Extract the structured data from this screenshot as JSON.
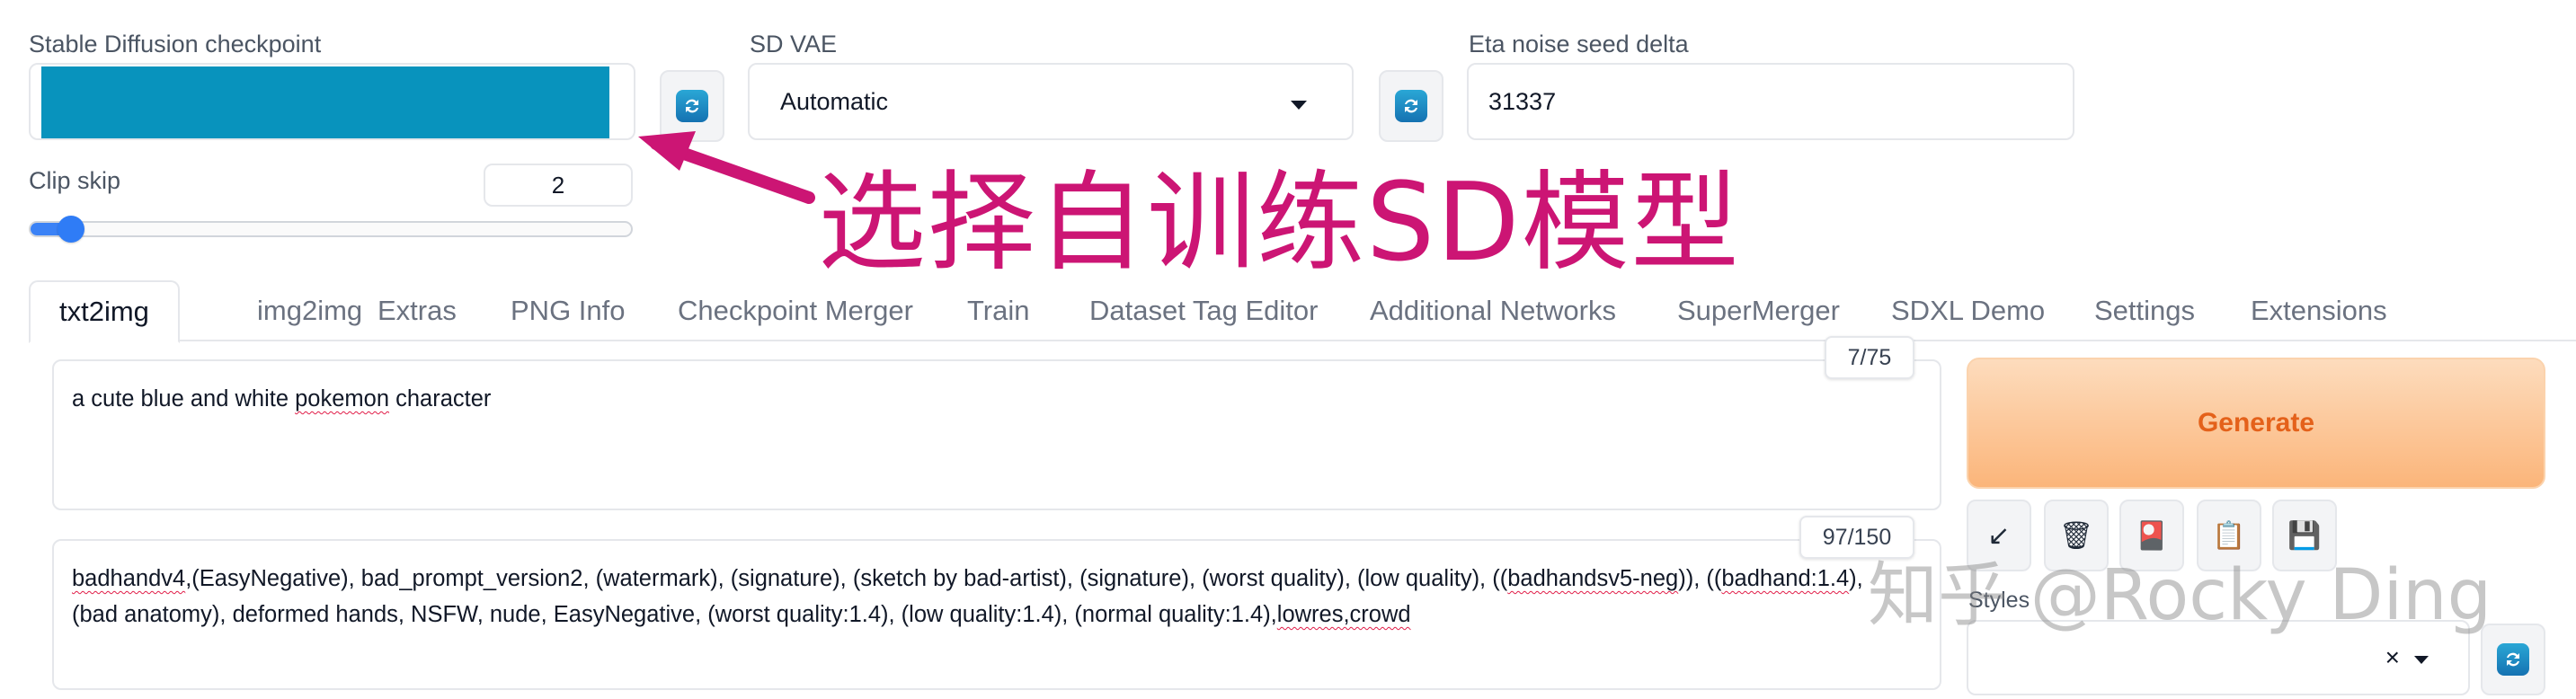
{
  "settings": {
    "checkpoint_label": "Stable Diffusion checkpoint",
    "checkpoint_fill_color": "#0893bd",
    "vae_label": "SD VAE",
    "vae_value": "Automatic",
    "eta_label": "Eta noise seed delta",
    "eta_value": "31337",
    "clip_skip_label": "Clip skip",
    "clip_skip_value": "2",
    "refresh_icon": "refresh-icon"
  },
  "annotation": {
    "text": "选择自训练SD模型",
    "color": "#cc1574"
  },
  "tabs": [
    {
      "label": "txt2img",
      "active": true
    },
    {
      "label": "img2img"
    },
    {
      "label": "Extras"
    },
    {
      "label": "PNG Info"
    },
    {
      "label": "Checkpoint Merger"
    },
    {
      "label": "Train"
    },
    {
      "label": "Dataset Tag Editor"
    },
    {
      "label": "Additional Networks"
    },
    {
      "label": "SuperMerger"
    },
    {
      "label": "SDXL Demo"
    },
    {
      "label": "Settings"
    },
    {
      "label": "Extensions"
    }
  ],
  "prompt": {
    "positive_part1": "a cute  blue and white ",
    "positive_word_pokemon": "pokemon",
    "positive_part2": " character",
    "positive_counter": "7/75",
    "negative_badhandv4": "badhandv4",
    "negative_line1": ",(EasyNegative), bad_prompt_version2, (watermark), (signature), (sketch by bad-artist), (signature), (worst quality), (low quality), ((",
    "negative_badhandsv5": "badhandsv5-neg",
    "negative_line1b": ")), ((",
    "negative_badhand": "badhand:1.4",
    "negative_line1c": "),",
    "negative_line2": "(bad anatomy), deformed hands, NSFW, nude, EasyNegative, (worst quality:1.4), (low quality:1.4), (normal quality:1.4),",
    "negative_lowres": "lowres,crowd",
    "negative_counter": "97/150"
  },
  "actions": {
    "generate_label": "Generate",
    "generate_color": "#e4611a",
    "tool_icons": [
      "arrow-down-left-icon",
      "trash-icon",
      "red-card-icon",
      "clipboard-icon",
      "save-icon"
    ],
    "tool_glyphs": [
      "↙",
      "🗑",
      "🎴",
      "📋",
      "💾"
    ],
    "styles_label": "Styles",
    "styles_clear": "×"
  },
  "watermark": "知乎 @Rocky Ding"
}
